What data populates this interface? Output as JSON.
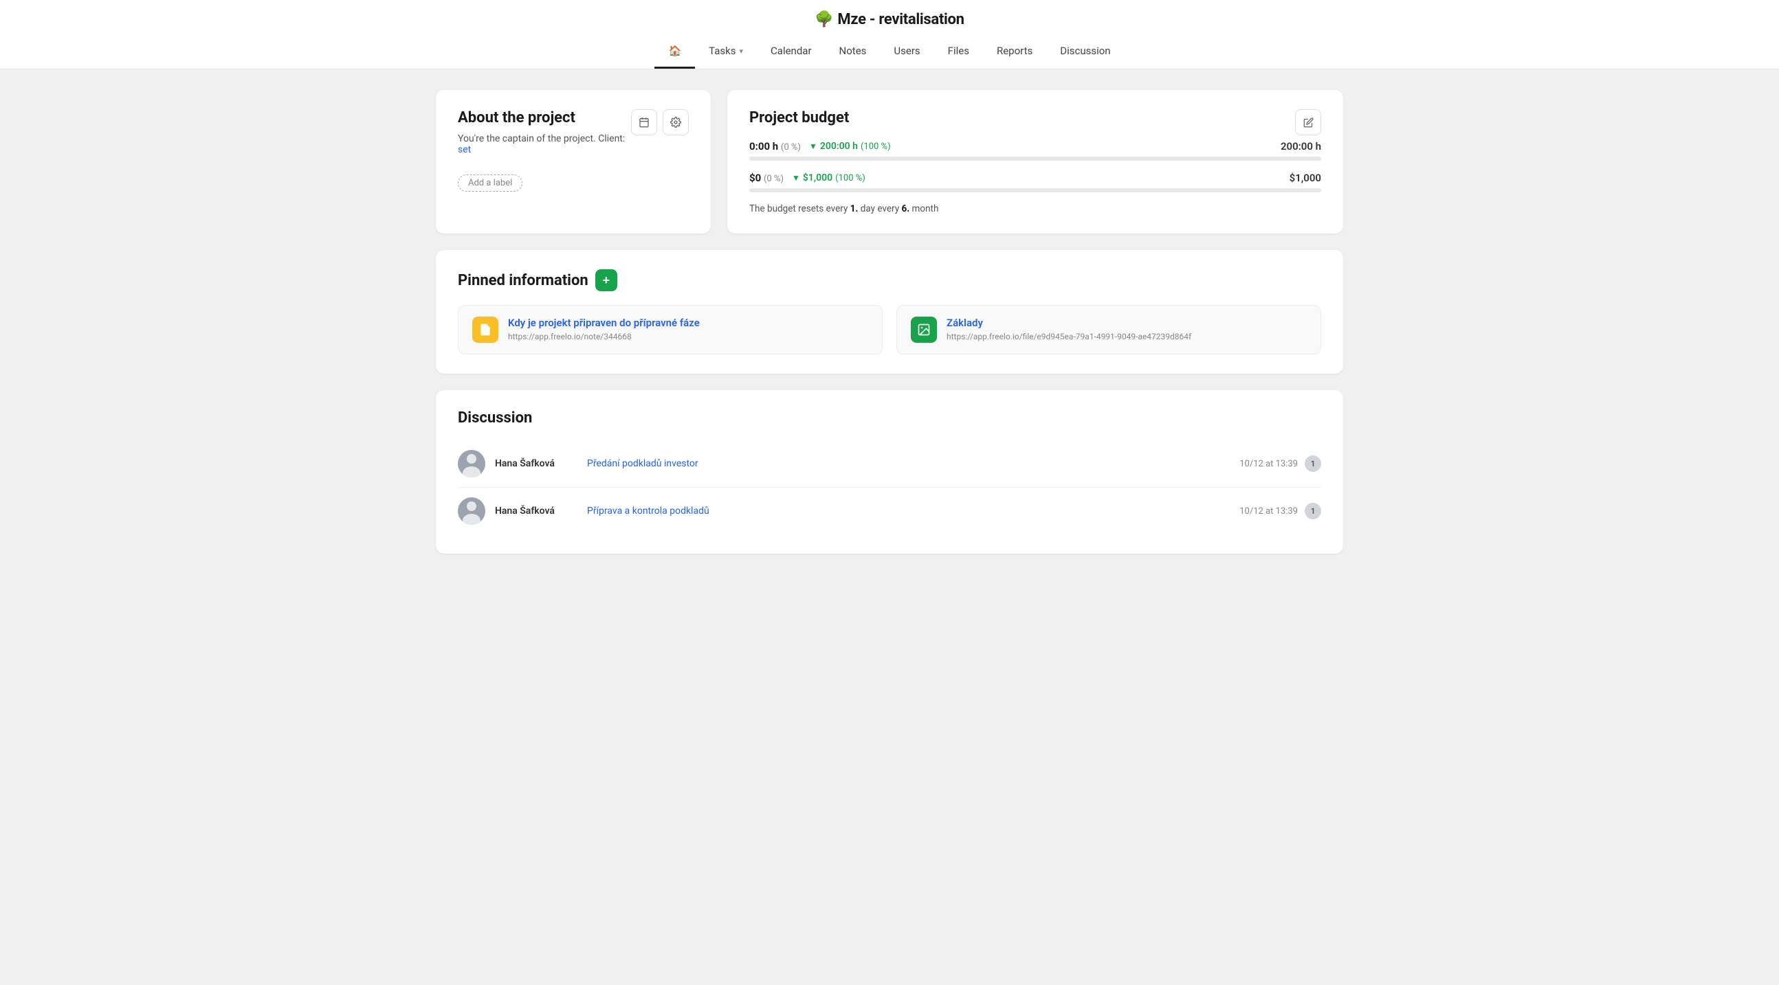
{
  "app": {
    "title": "Mze - revitalisation",
    "emoji": "🌳"
  },
  "nav": {
    "items": [
      {
        "id": "home",
        "label": "",
        "icon": "🏠",
        "active": true
      },
      {
        "id": "tasks",
        "label": "Tasks",
        "hasChevron": true
      },
      {
        "id": "calendar",
        "label": "Calendar"
      },
      {
        "id": "notes",
        "label": "Notes"
      },
      {
        "id": "users",
        "label": "Users"
      },
      {
        "id": "files",
        "label": "Files"
      },
      {
        "id": "reports",
        "label": "Reports"
      },
      {
        "id": "discussion",
        "label": "Discussion"
      }
    ]
  },
  "about": {
    "title": "About the project",
    "subtitle": "You're the captain of the project. Client:",
    "client_link": "set",
    "add_label": "Add a label"
  },
  "budget": {
    "title": "Project budget",
    "hours": {
      "current": "0:00 h",
      "current_pct": "(0 %)",
      "used": "200:00 h",
      "used_pct": "(100 %)",
      "total": "200:00 h",
      "fill_pct": 0
    },
    "money": {
      "current": "$0",
      "current_pct": "(0 %)",
      "used": "$1,000",
      "used_pct": "(100 %)",
      "total": "$1,000",
      "fill_pct": 0
    },
    "note": "The budget resets every",
    "note_day": "1.",
    "note_mid": "day every",
    "note_month": "6.",
    "note_end": "month"
  },
  "pinned": {
    "title": "Pinned information",
    "items": [
      {
        "icon_type": "yellow",
        "icon": "📄",
        "title": "Kdy je projekt připraven do přípravné fáze",
        "url": "https://app.freelo.io/note/344668"
      },
      {
        "icon_type": "green",
        "icon": "🖼",
        "title": "Základy",
        "url": "https://app.freelo.io/file/e9d945ea-79a1-4991-9049-ae47239d864f"
      }
    ]
  },
  "discussion": {
    "title": "Discussion",
    "items": [
      {
        "user": "Hana Šafková",
        "link_text": "Předání podkladů investor",
        "time": "10/12 at 13:39",
        "count": "1"
      },
      {
        "user": "Hana Šafková",
        "link_text": "Příprava a kontrola podkladů",
        "time": "10/12 at 13:39",
        "count": "1"
      }
    ]
  }
}
